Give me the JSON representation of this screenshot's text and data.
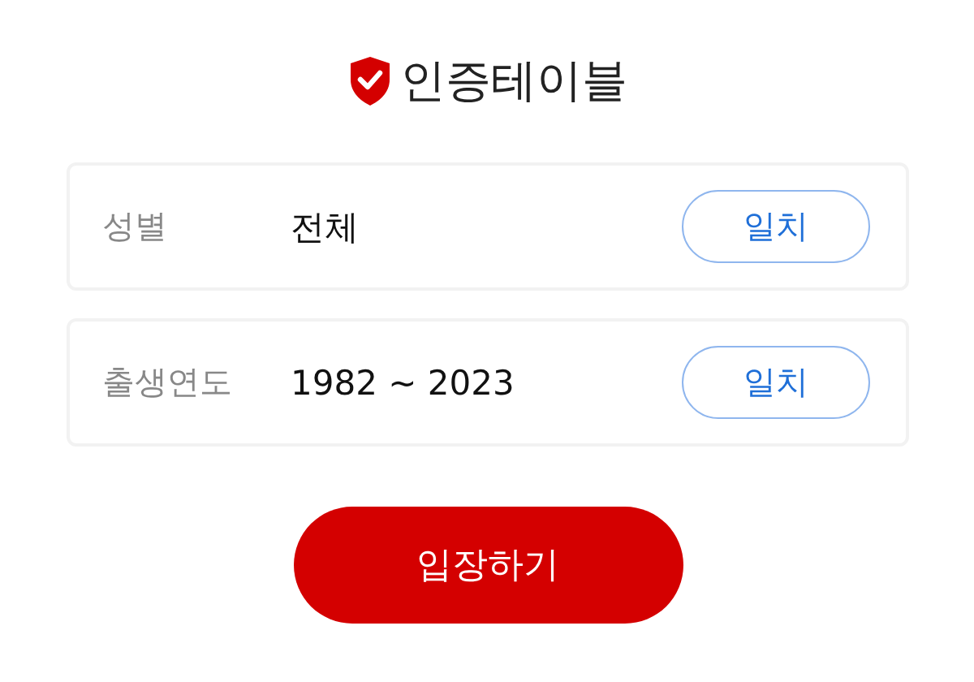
{
  "title": "인증테이블",
  "rows": [
    {
      "label": "성별",
      "value": "전체",
      "button": "일치"
    },
    {
      "label": "출생연도",
      "value": "1982 ~ 2023",
      "button": "일치"
    }
  ],
  "enter_button": "입장하기"
}
